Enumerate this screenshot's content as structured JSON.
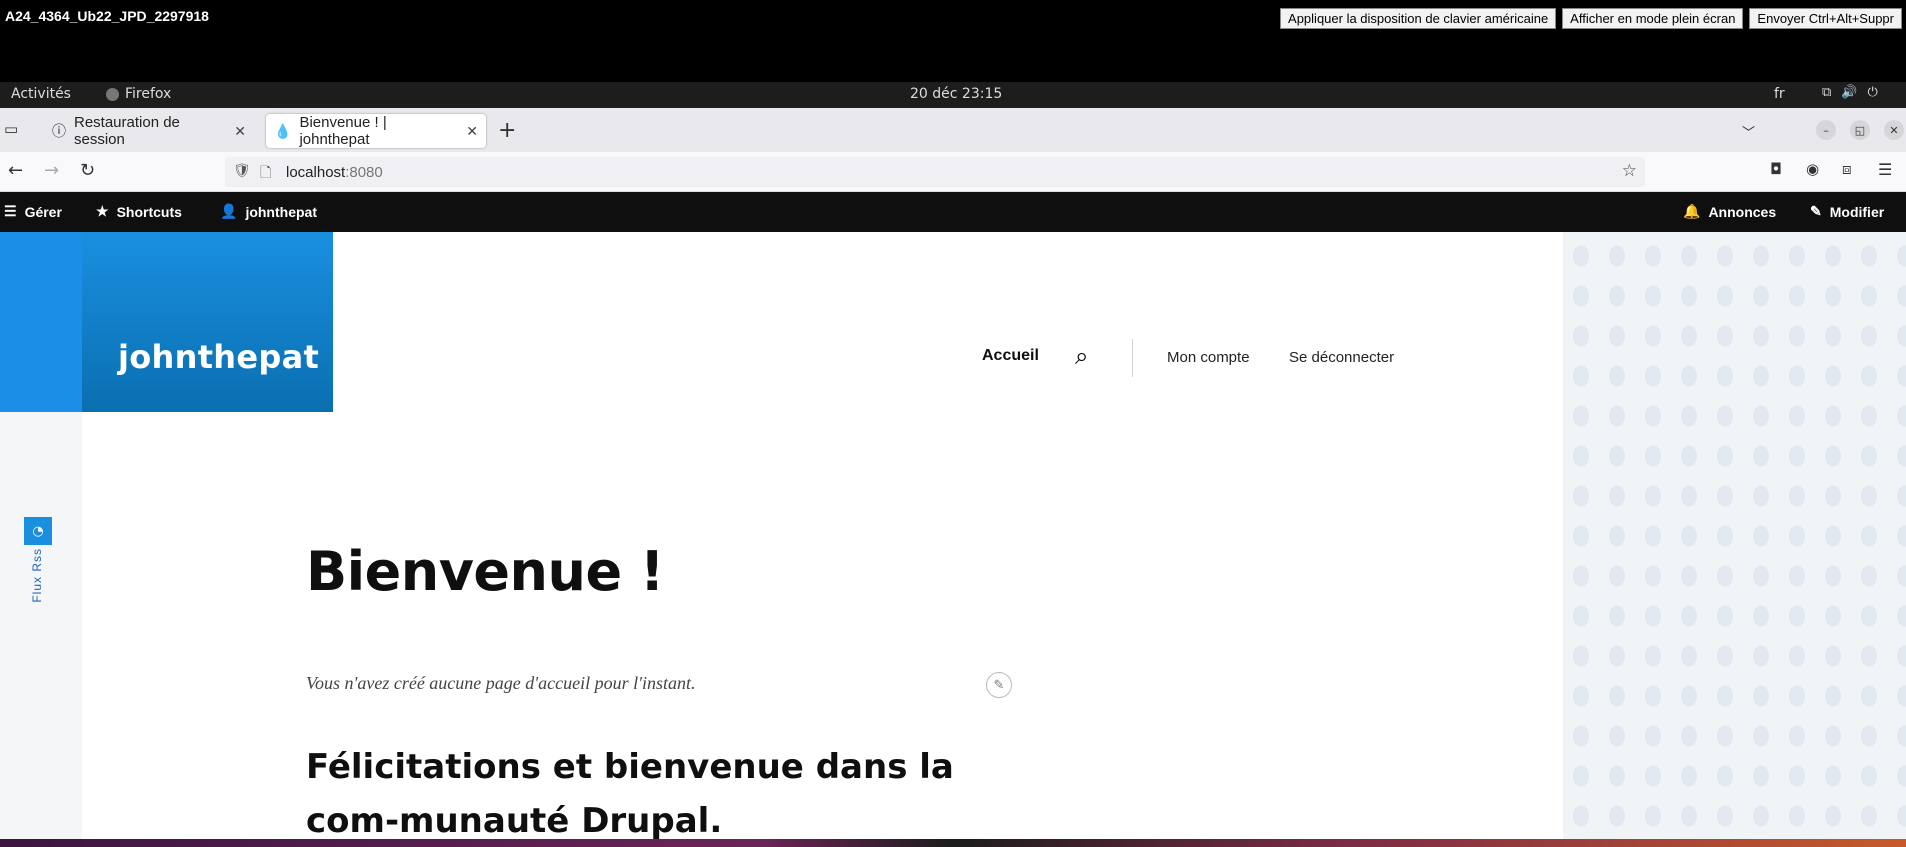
{
  "vnc": {
    "title": "A24_4364_Ub22_JPD_2297918",
    "buttons": [
      "Appliquer la disposition de clavier américaine",
      "Afficher en mode plein écran",
      "Envoyer Ctrl+Alt+Suppr"
    ]
  },
  "gnome": {
    "activities": "Activités",
    "app": "Firefox",
    "clock": "20 déc  23:15",
    "lang": "fr"
  },
  "browser": {
    "tabs": [
      {
        "label": "Restauration de session",
        "icon": "info-icon"
      },
      {
        "label": "Bienvenue ! | johnthepat",
        "icon": "drupal-drop-icon"
      }
    ],
    "url_host": "localhost",
    "url_port": ":8080"
  },
  "toolbar": {
    "manage": "Gérer",
    "shortcuts": "Shortcuts",
    "user": "johnthepat",
    "announcements": "Annonces",
    "edit": "Modifier"
  },
  "site": {
    "name": "johnthepat",
    "nav_home": "Accueil",
    "nav_account": "Mon compte",
    "nav_logout": "Se déconnecter",
    "rss_label": "Flux Rss",
    "title": "Bienvenue !",
    "intro": "Vous n'avez créé aucune page d'accueil pour l'instant.",
    "heading": "Félicitations et bienvenue dans la com-munauté Drupal."
  }
}
